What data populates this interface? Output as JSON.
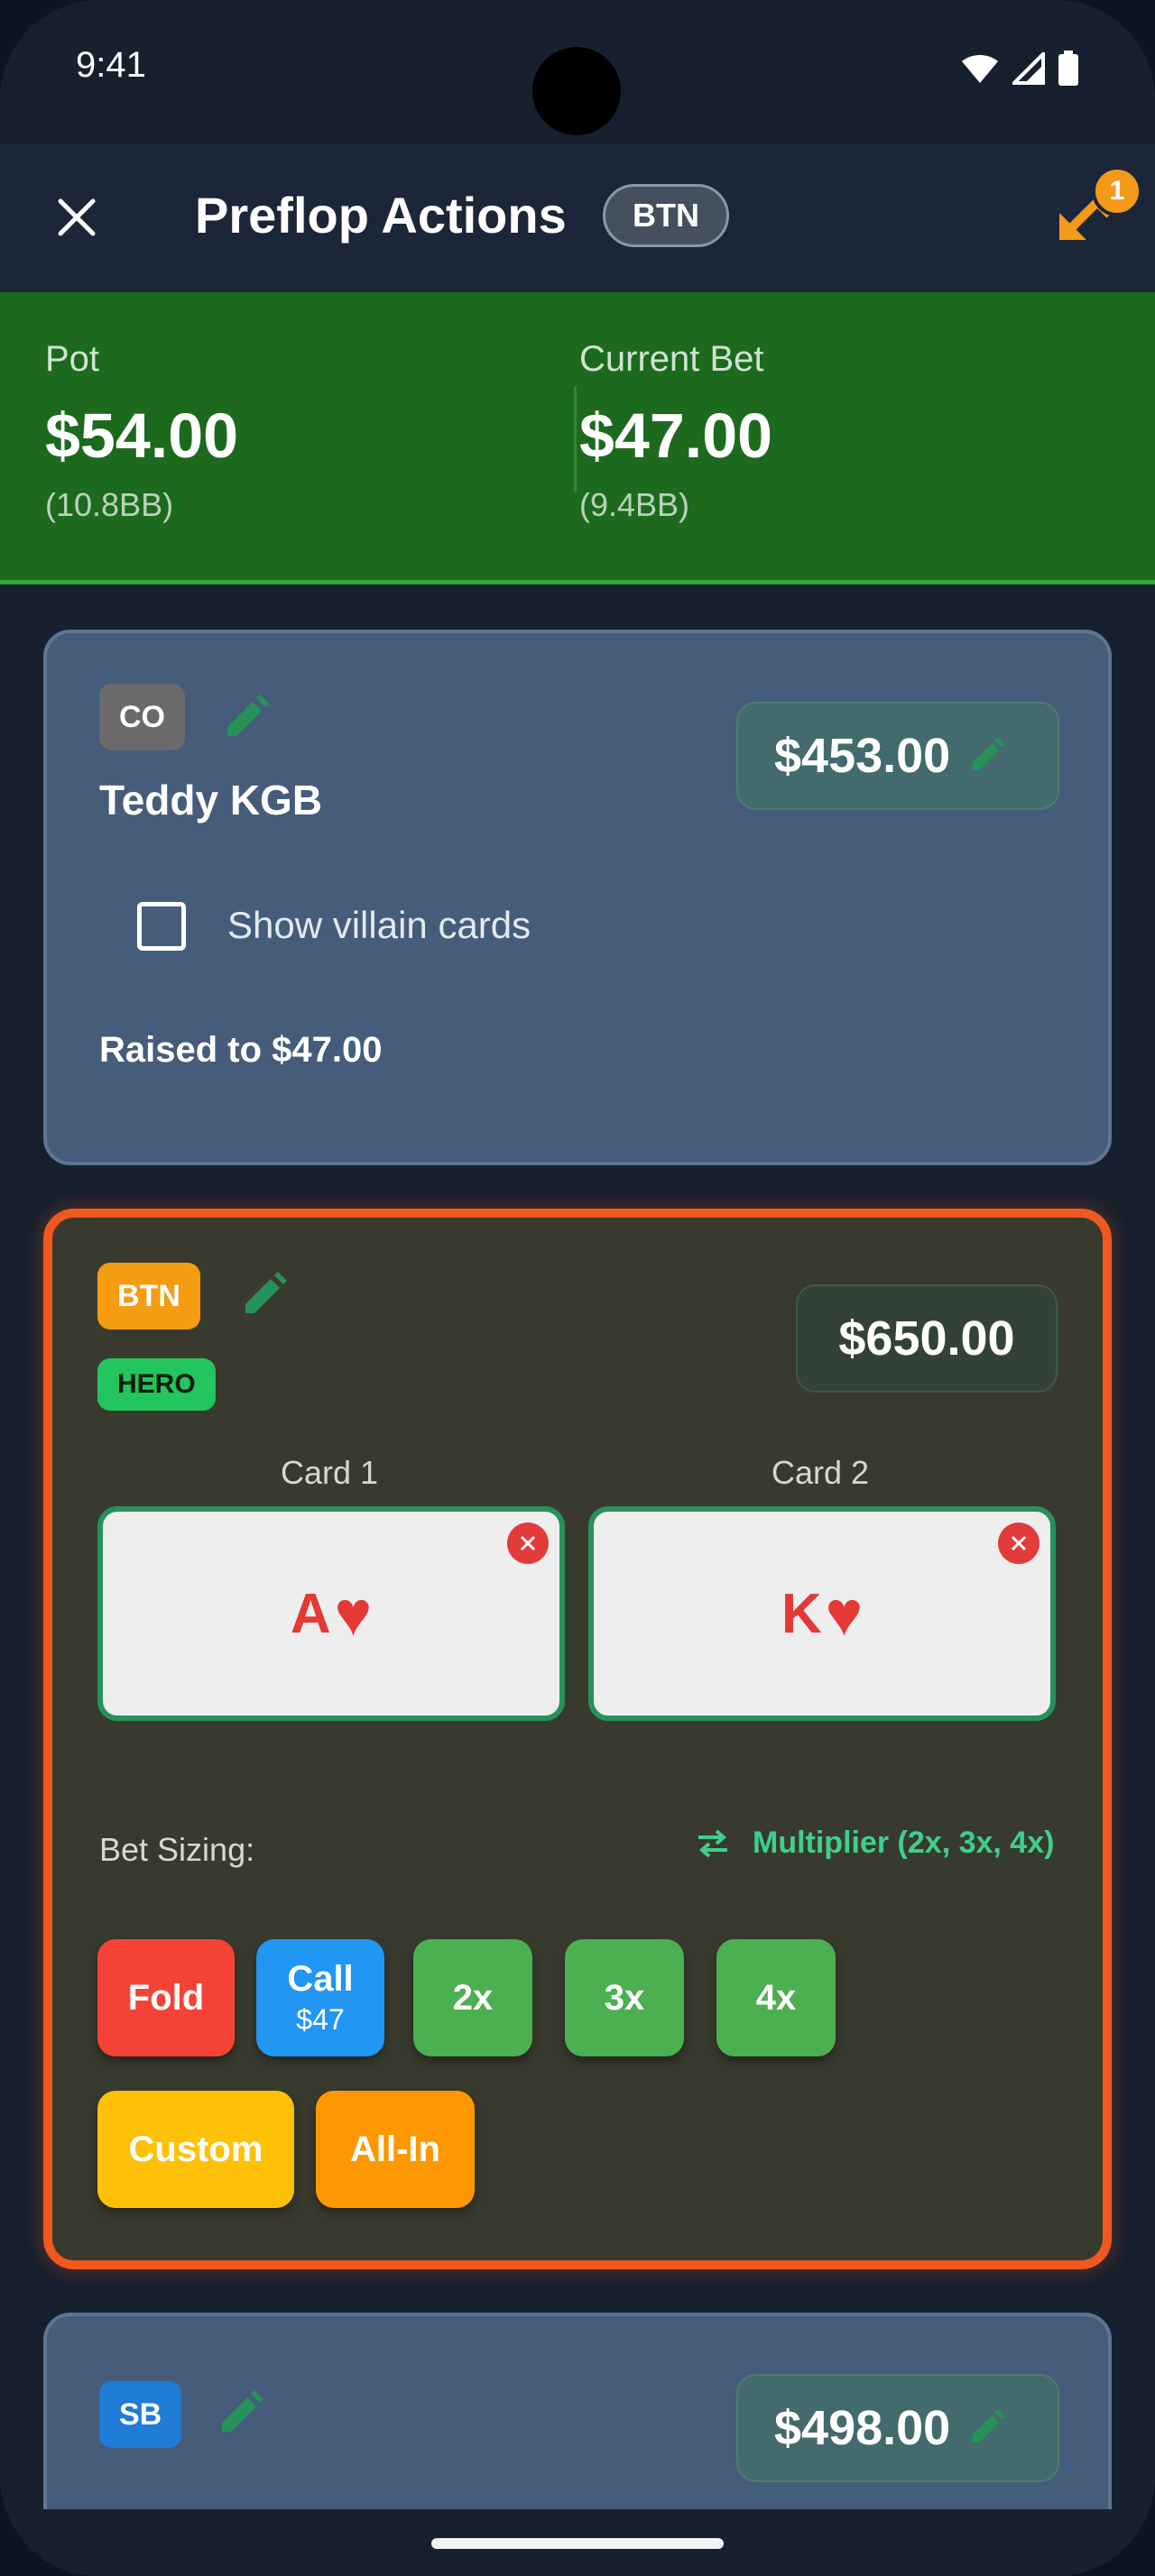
{
  "status_bar": {
    "time": "9:41"
  },
  "header": {
    "title": "Preflop Actions",
    "position_chip": "BTN",
    "undo_count": "1"
  },
  "pot_summary": {
    "pot_label": "Pot",
    "pot_amount": "$54.00",
    "pot_bb": "(10.8BB)",
    "bet_label": "Current Bet",
    "bet_amount": "$47.00",
    "bet_bb": "(9.4BB)"
  },
  "players": {
    "villain": {
      "position": "CO",
      "name": "Teddy KGB",
      "stack": "$453.00",
      "show_cards_label": "Show villain cards",
      "action": "Raised to $47.00"
    },
    "hero": {
      "position": "BTN",
      "tag": "HERO",
      "stack": "$650.00",
      "card1_label": "Card 1",
      "card1_rank": "A",
      "card1_suit": "♥",
      "card2_label": "Card 2",
      "card2_rank": "K",
      "card2_suit": "♥",
      "bet_sizing_label": "Bet Sizing:",
      "sizing_mode": "Multiplier (2x, 3x, 4x)",
      "actions": {
        "fold": "Fold",
        "call": "Call",
        "call_amount": "$47",
        "x2": "2x",
        "x3": "3x",
        "x4": "4x",
        "custom": "Custom",
        "allin": "All-In"
      }
    },
    "sb": {
      "position": "SB",
      "stack": "$498.00"
    }
  },
  "colors": {
    "background": "#17202e",
    "pot_band": "#1d6a1f",
    "villain_card": "#455d7a",
    "hero_card": "#393a2e",
    "hero_border": "#f0581e",
    "fold": "#f44336",
    "call": "#2196f3",
    "raise": "#4caf50",
    "custom": "#ffc107",
    "allin": "#ff9800",
    "accent_green": "#3ecf8e"
  }
}
